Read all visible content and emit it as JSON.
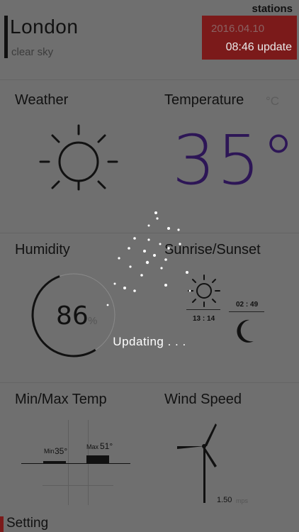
{
  "header": {
    "stations_label": "stations",
    "city": "London",
    "description": "clear sky",
    "date": "2016.04.10",
    "update_label": "08:46 update",
    "accent_color": "#7b1a1a"
  },
  "weather": {
    "title": "Weather",
    "icon": "sun-icon"
  },
  "temperature": {
    "title": "Temperature",
    "unit": "°C",
    "value": "35°",
    "color": "#2d1656"
  },
  "humidity": {
    "title": "Humidity",
    "value": "86",
    "unit": "%",
    "fraction": 0.86
  },
  "sun": {
    "title": "Sunrise/Sunset",
    "sunrise_time": "13 : 14",
    "sunset_time": "02 : 49",
    "sun_icon": "small-sun-icon",
    "moon_icon": "moon-icon"
  },
  "minmax": {
    "title": "Min/Max Temp",
    "min_label": "Min",
    "min_value": "35°",
    "max_label": "Max",
    "max_value": "51°"
  },
  "wind": {
    "title": "Wind Speed",
    "value": "1.50",
    "unit": "mps",
    "icon": "wind-turbine-icon"
  },
  "overlay": {
    "text": "Updating . . ."
  },
  "footer": {
    "setting_label": "Setting"
  }
}
